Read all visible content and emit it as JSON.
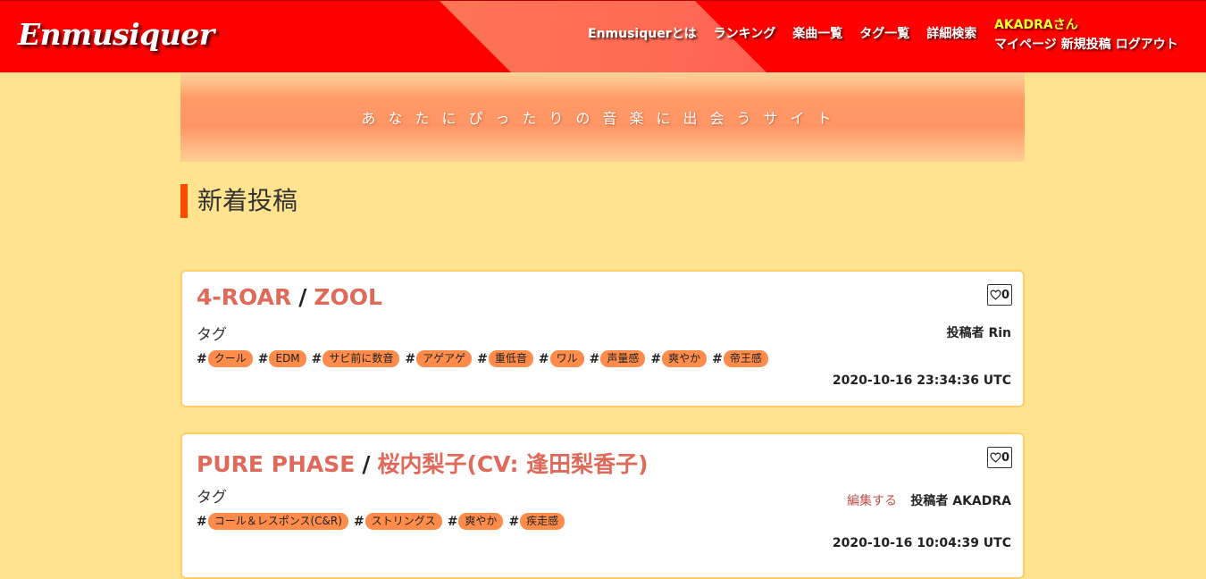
{
  "header": {
    "logo": "Enmusiquer",
    "nav": [
      "Enmusiquerとは",
      "ランキング",
      "楽曲一覧",
      "タグ一覧",
      "詳細検索"
    ],
    "user_greeting": "AKADRAさん",
    "user_links": [
      "マイページ",
      "新規投稿",
      "ログアウト"
    ]
  },
  "banner": {
    "text": "あなたにぴったりの音楽に出会うサイト"
  },
  "section": {
    "title": "新着投稿"
  },
  "posts": [
    {
      "song": "4-ROAR",
      "separator": "/",
      "artist": "ZOOL",
      "likes": "0",
      "tag_label": "タグ",
      "poster": "投稿者 Rin",
      "edit_label": "",
      "tags": [
        "クール",
        "EDM",
        "サビ前に数音",
        "アゲアゲ",
        "重低音",
        "ワル",
        "声量感",
        "爽やか",
        "帝王感"
      ],
      "timestamp": "2020-10-16 23:34:36 UTC"
    },
    {
      "song": "PURE PHASE",
      "separator": "/",
      "artist": "桜内梨子(CV: 逢田梨香子)",
      "likes": "0",
      "tag_label": "タグ",
      "poster": "投稿者 AKADRA",
      "edit_label": "編集する",
      "tags": [
        "コール＆レスポンス(C&R)",
        "ストリングス",
        "爽やか",
        "疾走感"
      ],
      "timestamp": "2020-10-16 10:04:39 UTC"
    }
  ],
  "tag_prefix": "#",
  "icons": {
    "like": "heart-outline-icon"
  },
  "colors": {
    "header": "#ff0000",
    "background": "#ffe38f",
    "tag": "#ff8c4a",
    "title": "#e06a5a",
    "accent": "#ff4d00"
  }
}
